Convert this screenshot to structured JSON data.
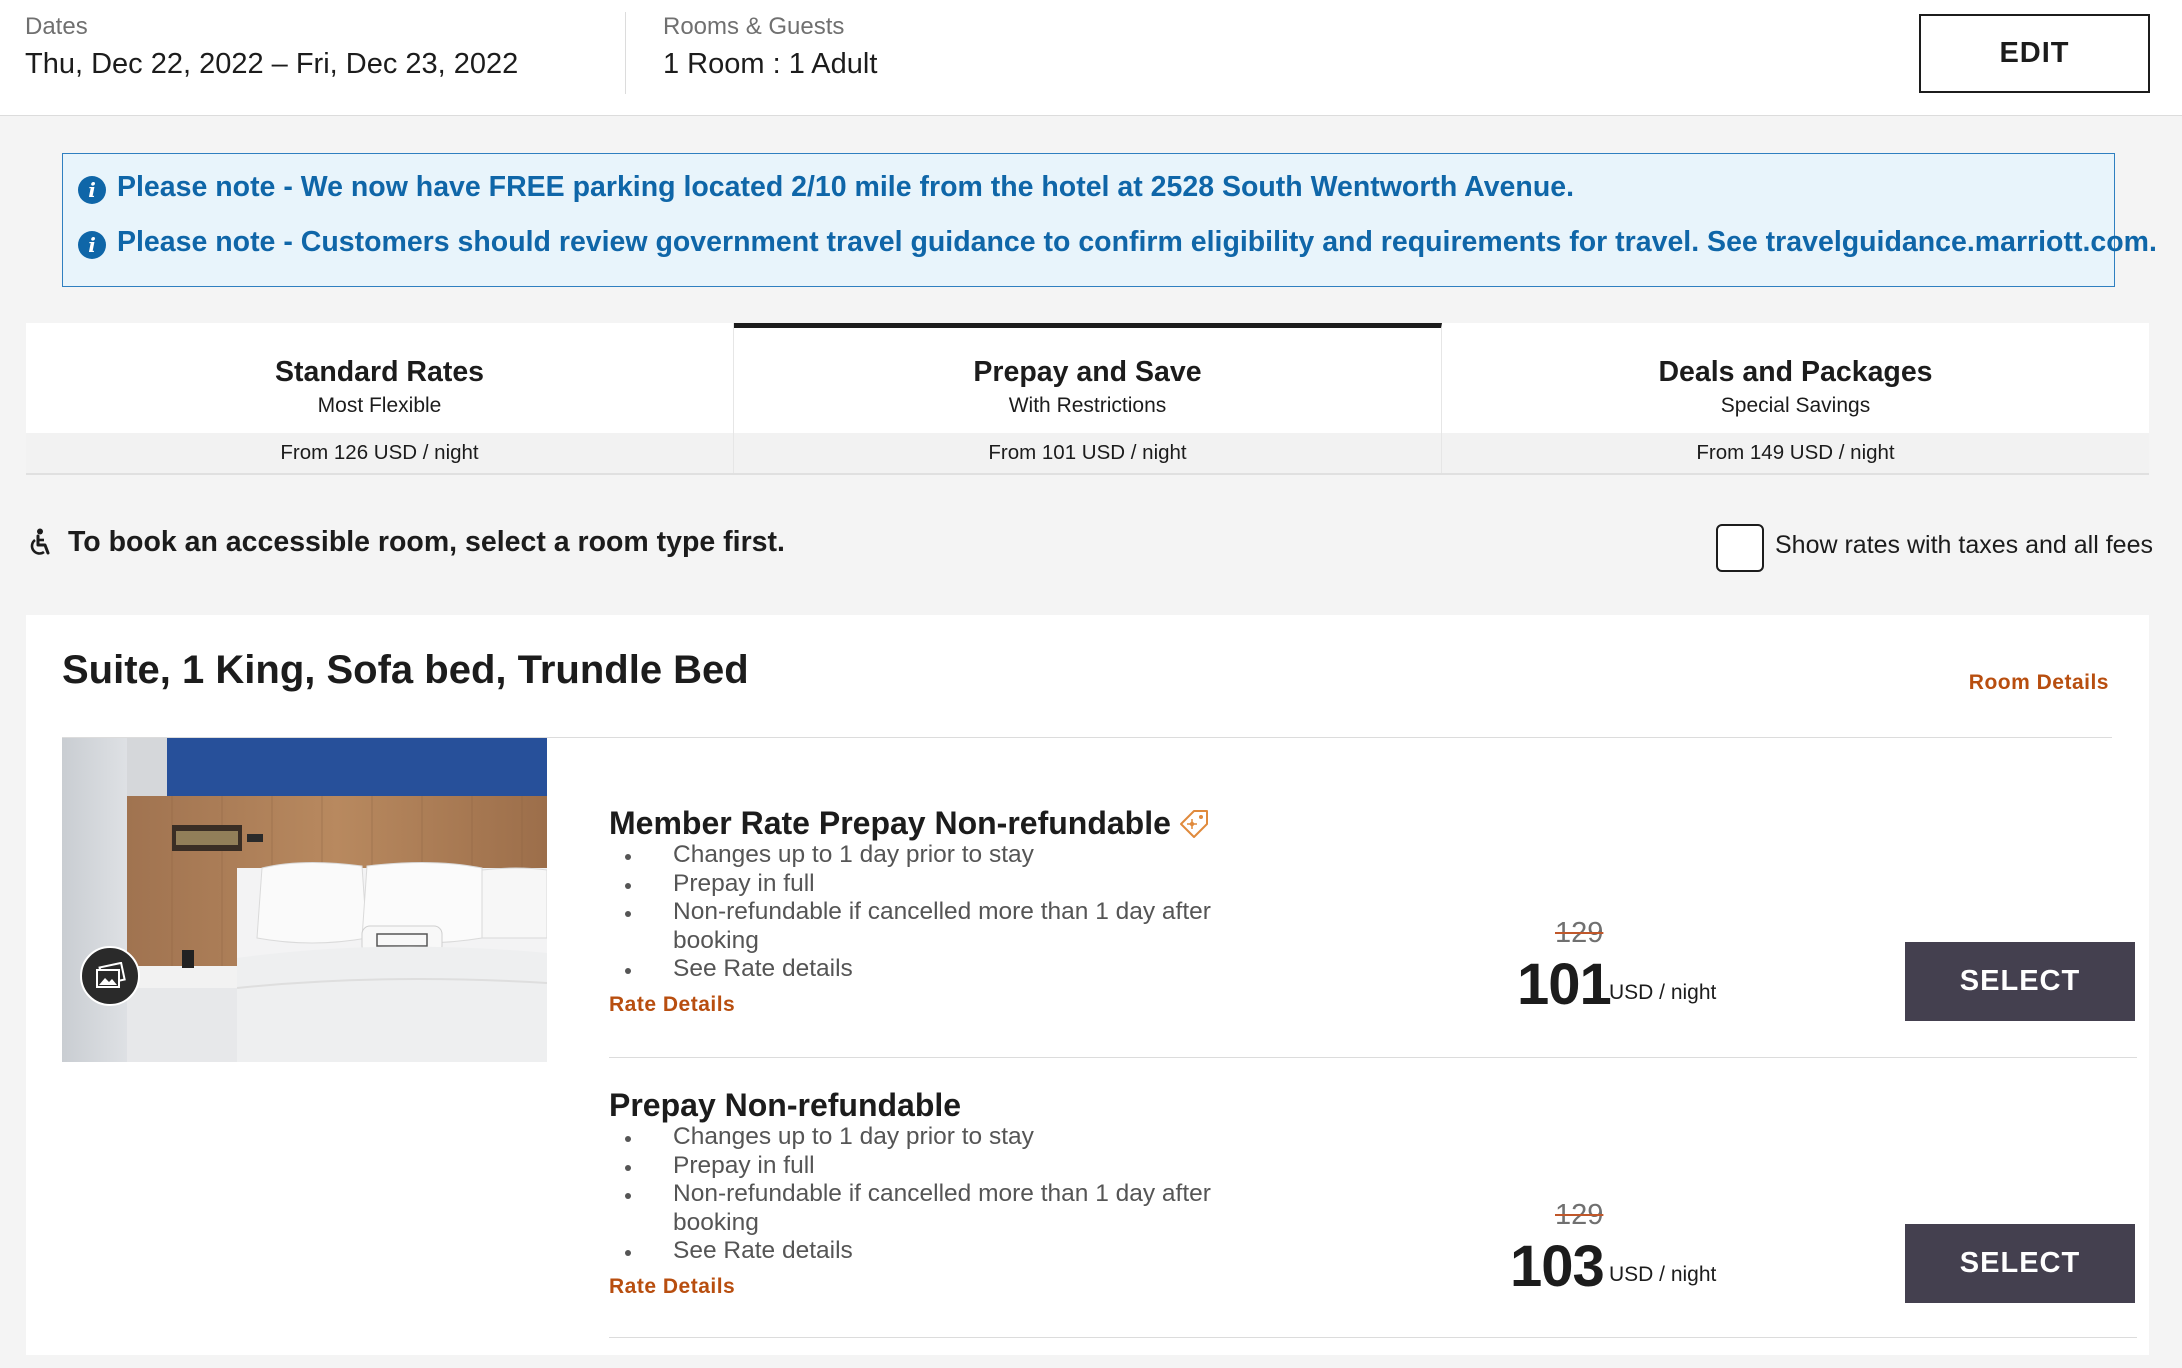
{
  "search": {
    "dates_label": "Dates",
    "dates_value": "Thu, Dec 22, 2022 – Fri, Dec 23, 2022",
    "rooms_label": "Rooms & Guests",
    "rooms_value": "1 Room : 1 Adult",
    "edit_label": "EDIT"
  },
  "notices": [
    "Please note - We now have FREE parking located 2/10 mile from the hotel at 2528 South Wentworth Avenue.",
    "Please note - Customers should review government travel guidance to confirm eligibility and requirements for travel. See travelguidance.marriott.com."
  ],
  "tabs": [
    {
      "title": "Standard Rates",
      "subtitle": "Most Flexible",
      "price": "From 126 USD / night",
      "active": false
    },
    {
      "title": "Prepay and Save",
      "subtitle": "With Restrictions",
      "price": "From 101 USD / night",
      "active": true
    },
    {
      "title": "Deals and Packages",
      "subtitle": "Special Savings",
      "price": "From 149 USD / night",
      "active": false
    }
  ],
  "accessible_note": "To book an accessible room, select a room type first.",
  "tax_toggle_label": "Show rates with taxes and all fees",
  "room": {
    "title": "Suite, 1 King, Sofa bed, Trundle Bed",
    "details_link": "Room Details",
    "rates": [
      {
        "title": "Member Rate Prepay Non-refundable",
        "has_member_tag": true,
        "bullets": [
          "Changes up to 1 day prior to stay",
          "Prepay in full",
          "Non-refundable if cancelled more than 1 day after booking",
          "See Rate details"
        ],
        "details_link": "Rate Details",
        "old_price": "129",
        "price": "101",
        "unit": "USD / night",
        "button": "SELECT"
      },
      {
        "title": "Prepay Non-refundable",
        "has_member_tag": false,
        "bullets": [
          "Changes up to 1 day prior to stay",
          "Prepay in full",
          "Non-refundable if cancelled more than 1 day after booking",
          "See Rate details"
        ],
        "details_link": "Rate Details",
        "old_price": "129",
        "price": "103",
        "unit": "USD / night",
        "button": "SELECT"
      }
    ]
  },
  "colors": {
    "accent_link": "#b84e0f",
    "notice_text": "#0f66a8",
    "select_button": "#44404f"
  }
}
